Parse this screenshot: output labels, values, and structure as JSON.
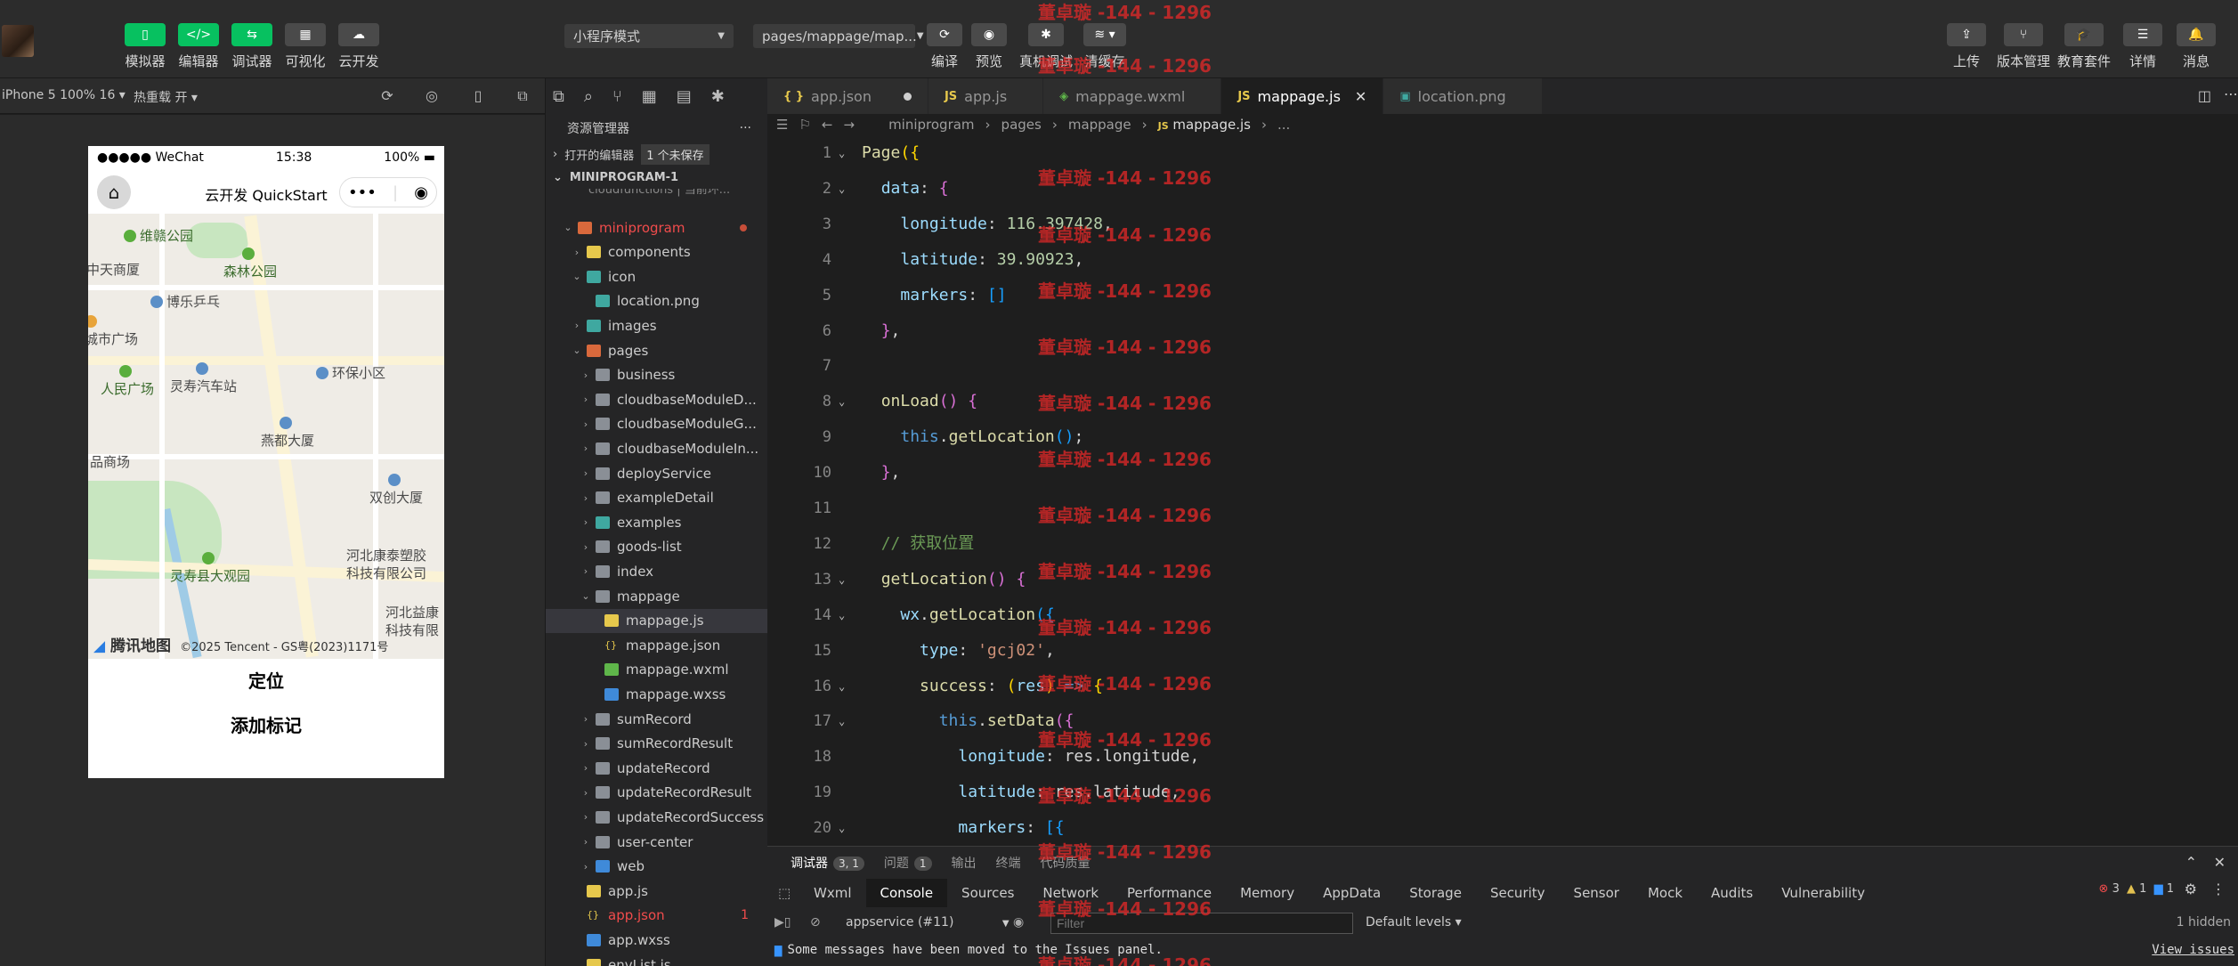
{
  "toolbar": {
    "left_buttons": [
      {
        "label": "模拟器",
        "icon": "phone-icon"
      },
      {
        "label": "编辑器",
        "icon": "code-icon"
      },
      {
        "label": "调试器",
        "icon": "debug-icon"
      },
      {
        "label": "可视化",
        "icon": "layout-icon"
      },
      {
        "label": "云开发",
        "icon": "cloud-icon"
      }
    ],
    "mode_select": "小程序模式",
    "page_select": "pages/mappage/map...",
    "center_buttons": [
      {
        "label": "编译"
      },
      {
        "label": "预览"
      },
      {
        "label": "真机调试"
      },
      {
        "label": "清缓存"
      }
    ],
    "right_buttons": [
      {
        "label": "上传"
      },
      {
        "label": "版本管理"
      },
      {
        "label": "教育套件"
      },
      {
        "label": "详情"
      },
      {
        "label": "消息"
      }
    ]
  },
  "watermark_text": "董卓璇 -144 - 1296",
  "device_bar": {
    "device": "iPhone 5 100% 16",
    "hot_reload": "热重载 开"
  },
  "phone": {
    "carrier": "●●●●● WeChat",
    "time": "15:38",
    "battery": "100%",
    "nav_title": "云开发 QuickStart",
    "capsule_more": "•••",
    "map_pois": [
      "维赣公园",
      "中天商厦",
      "森林公园",
      "博乐乒乓",
      "城市广场",
      "环保小区",
      "人民广场",
      "灵寿汽车站",
      "燕都大厦",
      "品商场",
      "双创大厦",
      "河北康泰塑胶",
      "科技有限公司",
      "灵寿县大观园",
      "河北益康",
      "科技有限"
    ],
    "map_brand": "腾讯地图",
    "map_copyright": "©2025 Tencent - GS粤(2023)1171号",
    "buttons": [
      "定位",
      "添加标记"
    ]
  },
  "explorer": {
    "title": "资源管理器",
    "more": "···",
    "open_editors": "打开的编辑器",
    "unsaved_badge": "1 个未保存",
    "project": "MINIPROGRAM-1",
    "cut_row": "cloudfunctions | 当前环...",
    "tree": [
      {
        "name": "miniprogram",
        "indent": 1,
        "type": "folder-r",
        "open": true,
        "red": true,
        "dot": true
      },
      {
        "name": "components",
        "indent": 2,
        "type": "folder-y",
        "open": false
      },
      {
        "name": "icon",
        "indent": 2,
        "type": "folder-t",
        "open": true
      },
      {
        "name": "location.png",
        "indent": 3,
        "type": "png"
      },
      {
        "name": "images",
        "indent": 2,
        "type": "folder-t",
        "open": false
      },
      {
        "name": "pages",
        "indent": 2,
        "type": "folder-r",
        "open": true
      },
      {
        "name": "business",
        "indent": 3,
        "type": "folder",
        "open": false
      },
      {
        "name": "cloudbaseModuleD...",
        "indent": 3,
        "type": "folder",
        "open": false
      },
      {
        "name": "cloudbaseModuleG...",
        "indent": 3,
        "type": "folder",
        "open": false
      },
      {
        "name": "cloudbaseModuleIn...",
        "indent": 3,
        "type": "folder",
        "open": false
      },
      {
        "name": "deployService",
        "indent": 3,
        "type": "folder",
        "open": false
      },
      {
        "name": "exampleDetail",
        "indent": 3,
        "type": "folder",
        "open": false
      },
      {
        "name": "examples",
        "indent": 3,
        "type": "folder-t",
        "open": false
      },
      {
        "name": "goods-list",
        "indent": 3,
        "type": "folder",
        "open": false
      },
      {
        "name": "index",
        "indent": 3,
        "type": "folder",
        "open": false
      },
      {
        "name": "mappage",
        "indent": 3,
        "type": "folder",
        "open": true
      },
      {
        "name": "mappage.js",
        "indent": 4,
        "type": "js",
        "selected": true
      },
      {
        "name": "mappage.json",
        "indent": 4,
        "type": "json"
      },
      {
        "name": "mappage.wxml",
        "indent": 4,
        "type": "wxml"
      },
      {
        "name": "mappage.wxss",
        "indent": 4,
        "type": "wxss"
      },
      {
        "name": "sumRecord",
        "indent": 3,
        "type": "folder",
        "open": false
      },
      {
        "name": "sumRecordResult",
        "indent": 3,
        "type": "folder",
        "open": false
      },
      {
        "name": "updateRecord",
        "indent": 3,
        "type": "folder",
        "open": false
      },
      {
        "name": "updateRecordResult",
        "indent": 3,
        "type": "folder",
        "open": false
      },
      {
        "name": "updateRecordSuccess",
        "indent": 3,
        "type": "folder",
        "open": false
      },
      {
        "name": "user-center",
        "indent": 3,
        "type": "folder",
        "open": false
      },
      {
        "name": "web",
        "indent": 3,
        "type": "folder-b",
        "open": false
      },
      {
        "name": "app.js",
        "indent": 2,
        "type": "js"
      },
      {
        "name": "app.json",
        "indent": 2,
        "type": "json",
        "red": true,
        "err": "1"
      },
      {
        "name": "app.wxss",
        "indent": 2,
        "type": "wxss"
      },
      {
        "name": "envList.js",
        "indent": 2,
        "type": "js"
      }
    ]
  },
  "editor": {
    "tabs": [
      {
        "label": "app.json",
        "icon": "{ }",
        "color": "#e6c84c",
        "active": false,
        "dirty": true
      },
      {
        "label": "app.js",
        "icon": "JS",
        "color": "#e6c84c",
        "active": false
      },
      {
        "label": "mappage.wxml",
        "icon": "◈",
        "color": "#5fb64a",
        "active": false
      },
      {
        "label": "mappage.js",
        "icon": "JS",
        "color": "#e6c84c",
        "active": true
      },
      {
        "label": "location.png",
        "icon": "▣",
        "color": "#3fa8a0",
        "active": false
      }
    ],
    "breadcrumb": [
      "miniprogram",
      "pages",
      "mappage",
      "mappage.js",
      "..."
    ],
    "code_lines": [
      {
        "n": "1",
        "fold": true,
        "html": "<span class='f'>Page</span><span class='br'>({</span>"
      },
      {
        "n": "2",
        "fold": true,
        "html": "  <span class='p'>data</span><span class='o'>: </span><span class='br2'>{</span>"
      },
      {
        "n": "3",
        "html": "    <span class='p'>longitude</span><span class='o'>: </span><span class='n'>116.397428</span><span class='o'>,</span>"
      },
      {
        "n": "4",
        "html": "    <span class='p'>latitude</span><span class='o'>: </span><span class='n'>39.90923</span><span class='o'>,</span>"
      },
      {
        "n": "5",
        "html": "    <span class='p'>markers</span><span class='o'>: </span><span class='br3'>[]</span>"
      },
      {
        "n": "6",
        "html": "  <span class='br2'>}</span><span class='o'>,</span>"
      },
      {
        "n": "7",
        "html": ""
      },
      {
        "n": "8",
        "fold": true,
        "html": "  <span class='f'>onLoad</span><span class='br2'>()</span><span class='o'> </span><span class='br2'>{</span>"
      },
      {
        "n": "9",
        "html": "    <span class='k'>this</span><span class='o'>.</span><span class='f'>getLocation</span><span class='br3'>()</span><span class='o'>;</span>"
      },
      {
        "n": "10",
        "html": "  <span class='br2'>}</span><span class='o'>,</span>"
      },
      {
        "n": "11",
        "html": ""
      },
      {
        "n": "12",
        "html": "  <span class='c'>// 获取位置</span>"
      },
      {
        "n": "13",
        "fold": true,
        "html": "  <span class='f'>getLocation</span><span class='br2'>()</span><span class='o'> </span><span class='br2'>{</span>"
      },
      {
        "n": "14",
        "fold": true,
        "html": "    <span class='p'>wx</span><span class='o'>.</span><span class='f'>getLocation</span><span class='br3'>({</span>"
      },
      {
        "n": "15",
        "html": "      <span class='p'>type</span><span class='o'>: </span><span class='s'>'gcj02'</span><span class='o'>,</span>"
      },
      {
        "n": "16",
        "fold": true,
        "html": "      <span class='f'>success</span><span class='o'>: </span><span class='br'>(</span><span class='p'>res</span><span class='br'>)</span><span class='o'> </span><span class='k'>=></span><span class='o'> </span><span class='br'>{</span>"
      },
      {
        "n": "17",
        "fold": true,
        "html": "        <span class='k'>this</span><span class='o'>.</span><span class='f'>setData</span><span class='br2'>({</span>"
      },
      {
        "n": "18",
        "html": "          <span class='p'>longitude</span><span class='o'>: res.longitude,</span>"
      },
      {
        "n": "19",
        "html": "          <span class='p'>latitude</span><span class='o'>: res.latitude,</span>"
      },
      {
        "n": "20",
        "fold": true,
        "html": "          <span class='p'>markers</span><span class='o'>: </span><span class='br3'>[{</span>"
      }
    ]
  },
  "debug": {
    "tabs": [
      {
        "label": "调试器",
        "count": "3, 1",
        "active": true
      },
      {
        "label": "问题",
        "count": "1"
      },
      {
        "label": "输出"
      },
      {
        "label": "终端"
      },
      {
        "label": "代码质量"
      }
    ],
    "devtools_tabs": [
      "Wxml",
      "Console",
      "Sources",
      "Network",
      "Performance",
      "Memory",
      "AppData",
      "Storage",
      "Security",
      "Sensor",
      "Mock",
      "Audits",
      "Vulnerability"
    ],
    "active_devtool": "Console",
    "error_count": "3",
    "warn_count": "1",
    "info_count": "1",
    "context": "appservice (#11)",
    "filter_placeholder": "Filter",
    "levels": "Default levels",
    "hidden": "1 hidden",
    "message": "Some messages have been moved to the Issues panel.",
    "view_issues": "View issues"
  }
}
